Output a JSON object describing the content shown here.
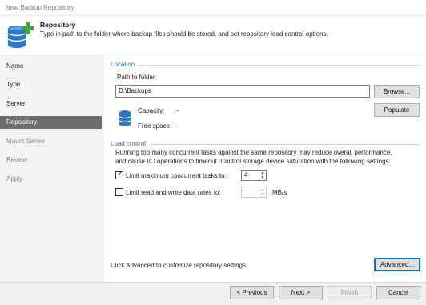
{
  "window": {
    "title": "New Backup Repository"
  },
  "header": {
    "title": "Repository",
    "description": "Type in path to the folder where backup files should be stored, and set repository load control options."
  },
  "sidebar": {
    "items": [
      {
        "label": "Name",
        "state": "normal"
      },
      {
        "label": "Type",
        "state": "normal"
      },
      {
        "label": "Server",
        "state": "normal"
      },
      {
        "label": "Repository",
        "state": "active"
      },
      {
        "label": "Mount Server",
        "state": "disabled"
      },
      {
        "label": "Review",
        "state": "disabled"
      },
      {
        "label": "Apply",
        "state": "disabled"
      }
    ]
  },
  "location": {
    "section_title": "Location",
    "path_label": "Path to folder:",
    "path_value": "D:\\Backups",
    "browse_label": "Browse...",
    "capacity_label": "Capacity:",
    "capacity_value": "--",
    "free_space_label": "Free space:",
    "free_space_value": "--",
    "populate_label": "Populate"
  },
  "load_control": {
    "section_title": "Load control",
    "description_line1": "Running too many concurrent tasks against the same repository may reduce overall performance,",
    "description_line2": "and cause I/O operations to timeout. Control storage device saturation with the following settings:",
    "limit_tasks_label": "Limit maximum concurrent tasks to:",
    "limit_tasks_checked": true,
    "limit_tasks_value": "4",
    "limit_rate_label": "Limit read and write data rates to:",
    "limit_rate_checked": false,
    "limit_rate_value": "",
    "limit_rate_unit": "MB/s"
  },
  "advanced": {
    "hint": "Click Advanced to customize repository settings",
    "button_label": "Advanced..."
  },
  "footer": {
    "previous_label": "< Previous",
    "next_label": "Next >",
    "finish_label": "Finish",
    "cancel_label": "Cancel"
  },
  "colors": {
    "accent": "#2f6fb5",
    "active_nav": "#6d6d6d",
    "plus_green": "#3aaa35",
    "db_blue": "#2a78c8"
  },
  "icons": {
    "header": "database-add-icon",
    "storage": "database-icon",
    "spinner_up": "▲",
    "spinner_down": "▼",
    "check": "✓"
  }
}
